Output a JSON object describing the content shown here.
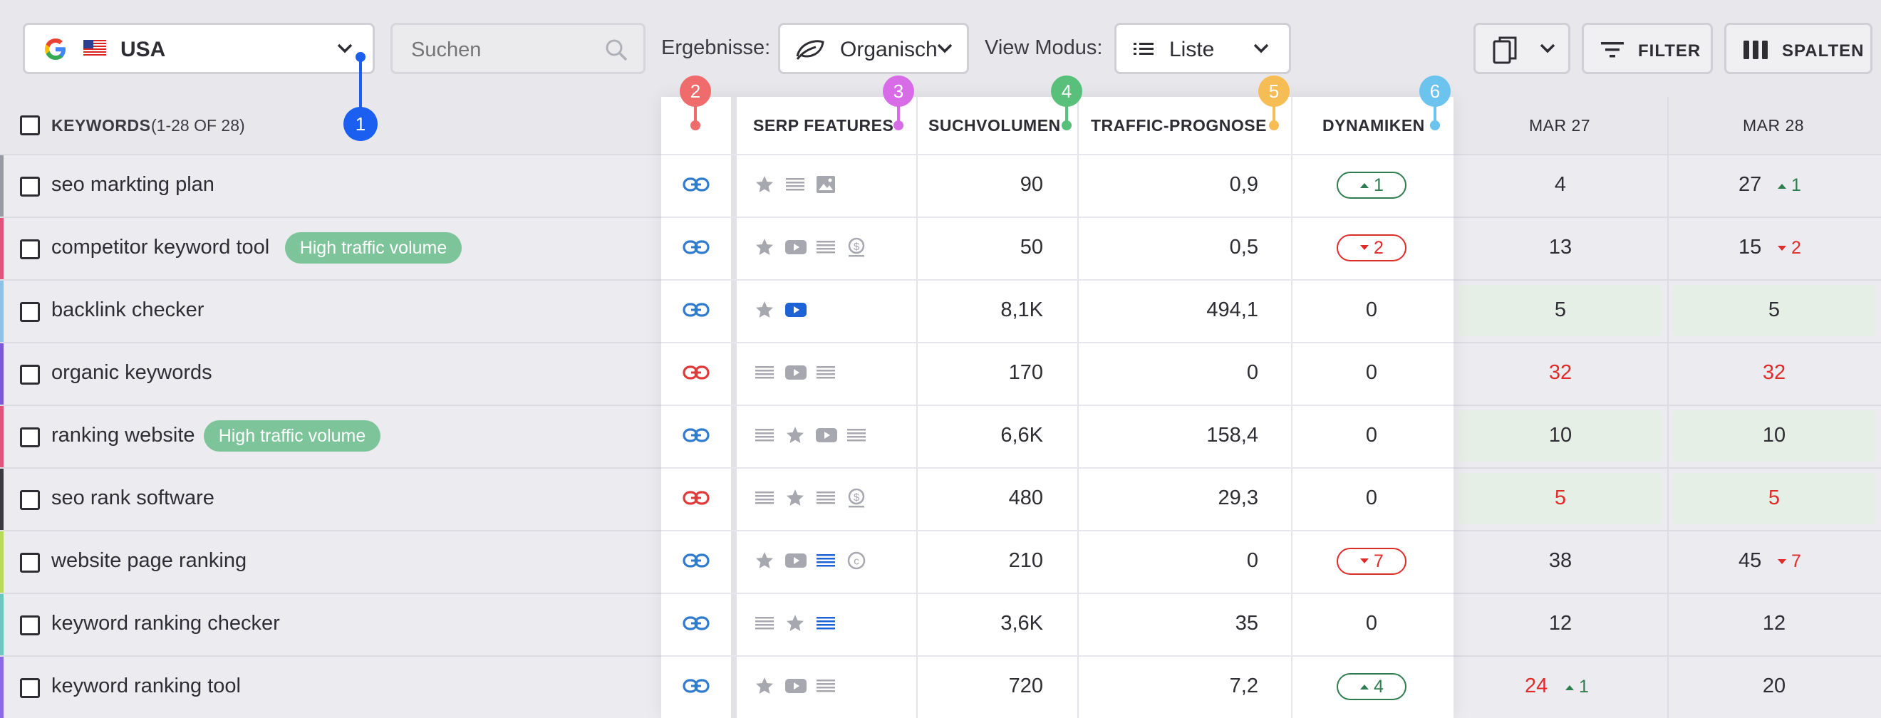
{
  "toolbar": {
    "country": "USA",
    "search_placeholder": "Suchen",
    "results_label": "Ergebnisse:",
    "results_value": "Organisch",
    "view_label": "View Modus:",
    "view_value": "Liste",
    "filter_label": "FILTER",
    "columns_label": "SPALTEN"
  },
  "table": {
    "keywords_header": "KEYWORDS",
    "keywords_count": "(1-28 OF 28)",
    "col_serp": "SERP FEATURES",
    "col_volume": "SUCHVOLUMEN",
    "col_traffic": "TRAFFIC-PROGNOSE",
    "col_dynamics": "DYNAMIKEN",
    "col_date1": "MAR 27",
    "col_date2": "MAR 28",
    "rows": [
      {
        "keyword": "seo markting plan",
        "tag": "",
        "volume": "90",
        "traffic": "0,9",
        "dyn": "1",
        "dyn_dir": "up",
        "d1": "4",
        "d2": "27",
        "d2_delta": "1",
        "d2_dir": "up"
      },
      {
        "keyword": "competitor keyword tool",
        "tag": "High traffic volume",
        "volume": "50",
        "traffic": "0,5",
        "dyn": "2",
        "dyn_dir": "down",
        "d1": "13",
        "d2": "15",
        "d2_delta": "2",
        "d2_dir": "down"
      },
      {
        "keyword": "backlink checker",
        "tag": "",
        "volume": "8,1K",
        "traffic": "494,1",
        "dyn": "0",
        "dyn_dir": "",
        "d1": "5",
        "d2": "5"
      },
      {
        "keyword": "organic keywords",
        "tag": "",
        "volume": "170",
        "traffic": "0",
        "dyn": "0",
        "dyn_dir": "",
        "d1": "32",
        "d2": "32"
      },
      {
        "keyword": "ranking website",
        "tag": "High traffic volume",
        "volume": "6,6K",
        "traffic": "158,4",
        "dyn": "0",
        "dyn_dir": "",
        "d1": "10",
        "d2": "10"
      },
      {
        "keyword": "seo rank software",
        "tag": "",
        "volume": "480",
        "traffic": "29,3",
        "dyn": "0",
        "dyn_dir": "",
        "d1": "5",
        "d2": "5"
      },
      {
        "keyword": "website page ranking",
        "tag": "",
        "volume": "210",
        "traffic": "0",
        "dyn": "7",
        "dyn_dir": "down",
        "d1": "38",
        "d2": "45",
        "d2_delta": "7",
        "d2_dir": "down"
      },
      {
        "keyword": "keyword ranking checker",
        "tag": "",
        "volume": "3,6K",
        "traffic": "35",
        "dyn": "0",
        "dyn_dir": "",
        "d1": "12",
        "d2": "12"
      },
      {
        "keyword": "keyword ranking tool",
        "tag": "",
        "volume": "720",
        "traffic": "7,2",
        "dyn": "4",
        "dyn_dir": "up",
        "d1": "24",
        "d1_delta": "1",
        "d1_dir": "up",
        "d2": "20"
      }
    ]
  },
  "markers": [
    "1",
    "2",
    "3",
    "4",
    "5",
    "6"
  ],
  "colors": {
    "accent_blue": "#1e63d6",
    "link_blue": "#2f7bd0",
    "link_red": "#e03a3a",
    "up_green": "#2e7d4f",
    "down_red": "#e02b2b",
    "tag_green": "#7dc49a",
    "marker1": "#1a5ff0",
    "marker2": "#f06b6b",
    "marker3": "#d76ce6",
    "marker4": "#59c07b",
    "marker5": "#f6bd55",
    "marker6": "#6cc3ee"
  }
}
